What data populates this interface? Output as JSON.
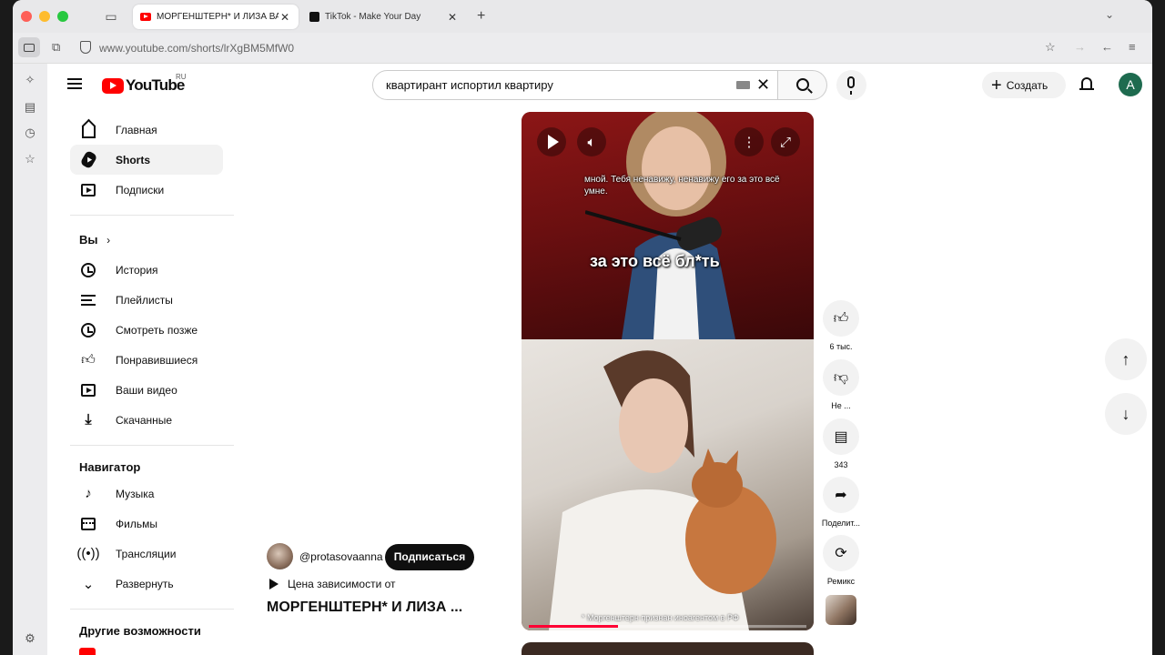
{
  "browser": {
    "tabs": [
      {
        "title": "МОРГЕНШТЕРН* И ЛИЗА ВАСИ",
        "active": true,
        "icon": "youtube-icon"
      },
      {
        "title": "TikTok - Make Your Day",
        "active": false,
        "icon": "tiktok-icon"
      }
    ],
    "new_tab_label": "+",
    "url": "www.youtube.com/shorts/lrXgBM5MfW0"
  },
  "header": {
    "logo_text": "YouTube",
    "region": "RU",
    "search_query": "квартирант испортил квартиру",
    "create_label": "Создать",
    "avatar_letter": "А"
  },
  "guide": {
    "main": [
      {
        "label": "Главная",
        "icon": "home-icon"
      },
      {
        "label": "Shorts",
        "icon": "shorts-icon",
        "active": true
      },
      {
        "label": "Подписки",
        "icon": "subscriptions-icon"
      }
    ],
    "you_header": "Вы",
    "you": [
      {
        "label": "История",
        "icon": "history-icon"
      },
      {
        "label": "Плейлисты",
        "icon": "playlists-icon"
      },
      {
        "label": "Смотреть позже",
        "icon": "watch-later-icon"
      },
      {
        "label": "Понравившиеся",
        "icon": "liked-icon"
      },
      {
        "label": "Ваши видео",
        "icon": "your-videos-icon"
      },
      {
        "label": "Скачанные",
        "icon": "downloads-icon"
      }
    ],
    "explore_header": "Навигатор",
    "explore": [
      {
        "label": "Музыка",
        "icon": "music-icon"
      },
      {
        "label": "Фильмы",
        "icon": "movies-icon"
      },
      {
        "label": "Трансляции",
        "icon": "live-icon"
      },
      {
        "label": "Развернуть",
        "icon": "chevron-down-icon"
      }
    ],
    "more_header": "Другие возможности"
  },
  "short": {
    "subtitle_top": "мной. Тебя ненавижу, ненавижу его за это всё умне.",
    "subtitle_main": "за это всё бл*ть",
    "footnote": "* Моргенштерн признан иноагентом в РФ",
    "progress": 0.32,
    "channel": "@protasovaanna",
    "subscribe_label": "Подписаться",
    "sound": "Цена зависимости от",
    "title": "МОРГЕНШТЕРН* И ЛИЗА ..."
  },
  "actions": {
    "likes": "6 тыс.",
    "dislike": "Не ...",
    "comments": "343",
    "share": "Поделит...",
    "remix": "Ремикс"
  },
  "colors": {
    "accent": "#ff0000",
    "progress": "#ff0033",
    "avatar": "#1e6b4f"
  }
}
